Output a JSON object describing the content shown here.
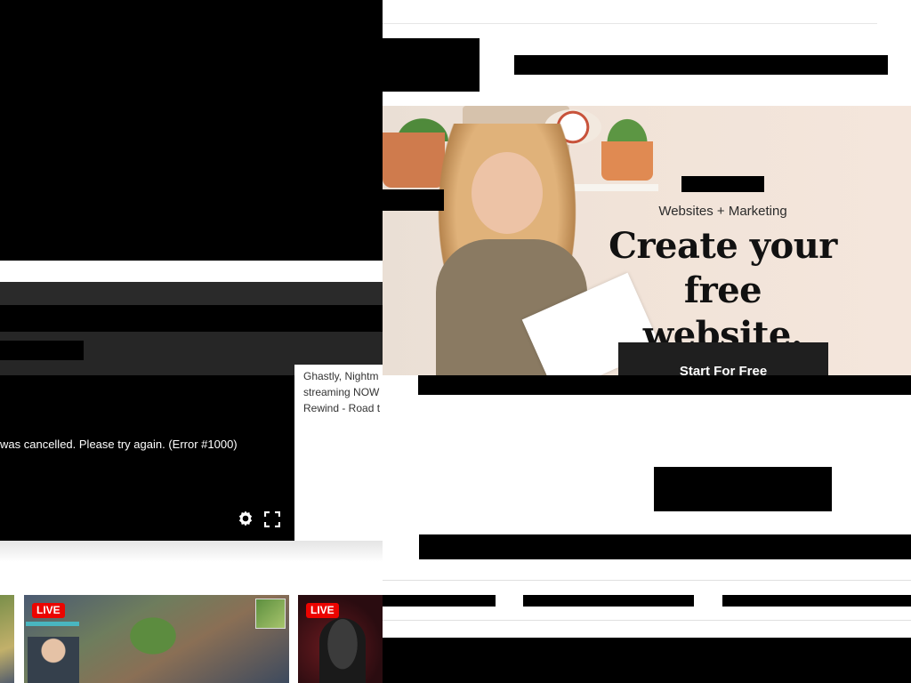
{
  "video": {
    "error_message": "was cancelled. Please try again. (Error #1000)",
    "settings_icon": "gear-icon",
    "fullscreen_icon": "fullscreen-icon",
    "description_lines": [
      "Ghastly, Nightm",
      "streaming NOW",
      "Rewind - Road t"
    ]
  },
  "thumbnails": [
    {
      "live_label": ""
    },
    {
      "live_label": "LIVE"
    },
    {
      "live_label": "LIVE"
    }
  ],
  "hero": {
    "kicker": "Websites + Marketing",
    "title_line_1": "Create your free",
    "title_line_2": "website.",
    "cta_label": "Start For Free"
  },
  "colors": {
    "live_badge": "#eb0400",
    "hero_background": "#f1e3d8",
    "cta_background": "#1f1f1f"
  }
}
